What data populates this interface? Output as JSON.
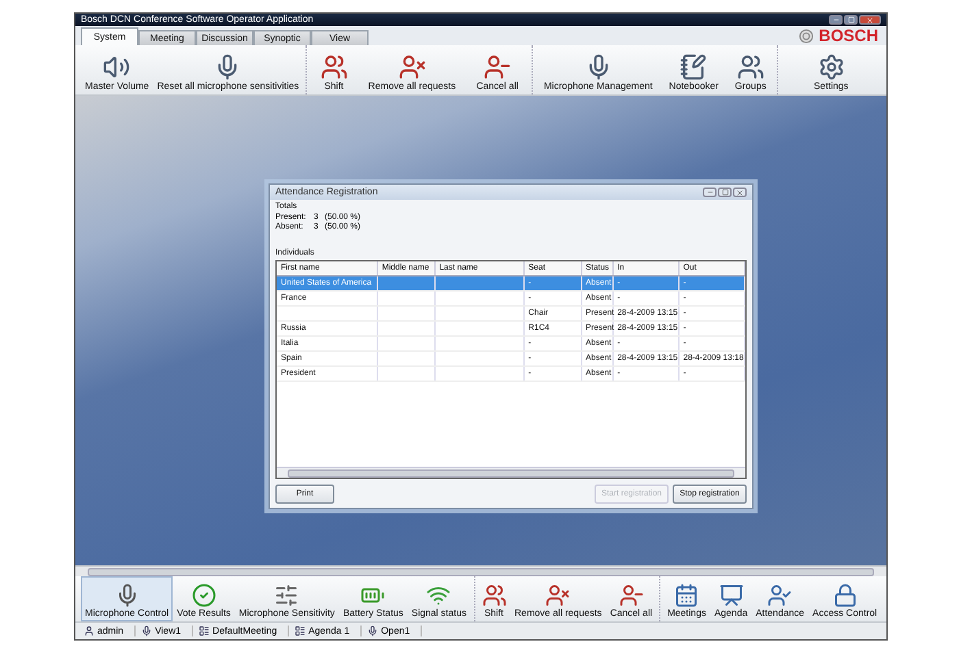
{
  "window": {
    "title": "Bosch DCN Conference Software Operator Application"
  },
  "tabs": [
    {
      "label": "System",
      "selected": true
    },
    {
      "label": "Meeting",
      "selected": false
    },
    {
      "label": "Discussion",
      "selected": false
    },
    {
      "label": "Synoptic",
      "selected": false
    },
    {
      "label": "View",
      "selected": false
    }
  ],
  "logo": "BOSCH",
  "toolbar": [
    [
      {
        "label": "Master Volume"
      },
      {
        "label": "Reset all microphone sensitivities"
      }
    ],
    [
      {
        "label": "Shift"
      },
      {
        "label": "Remove all requests"
      },
      {
        "label": "Cancel all"
      }
    ],
    [
      {
        "label": "Microphone Management"
      },
      {
        "label": "Notebooker"
      },
      {
        "label": "Groups"
      }
    ],
    [
      {
        "label": "Settings"
      }
    ]
  ],
  "dialog": {
    "title": "Attendance Registration",
    "totals_label": "Totals",
    "totals": [
      {
        "label": "Present:",
        "count": "3",
        "percent": "(50.00 %)"
      },
      {
        "label": "Absent:",
        "count": "3",
        "percent": "(50.00 %)"
      }
    ],
    "individuals_label": "Individuals",
    "columns": [
      "First name",
      "Middle name",
      "Last name",
      "Seat",
      "Status",
      "In",
      "Out"
    ],
    "rows": [
      {
        "cells": [
          "United States of America",
          "",
          "",
          "-",
          "Absent",
          "-",
          "-"
        ],
        "selected": true
      },
      {
        "cells": [
          "France",
          "",
          "",
          "-",
          "Absent",
          "-",
          "-"
        ],
        "selected": false
      },
      {
        "cells": [
          "",
          "",
          "",
          "Chair",
          "Present",
          "28-4-2009 13:15",
          "-"
        ],
        "selected": false
      },
      {
        "cells": [
          "Russia",
          "",
          "",
          "R1C4",
          "Present",
          "28-4-2009 13:15",
          "-"
        ],
        "selected": false
      },
      {
        "cells": [
          "Italia",
          "",
          "",
          "-",
          "Absent",
          "-",
          "-"
        ],
        "selected": false
      },
      {
        "cells": [
          "Spain",
          "",
          "",
          "-",
          "Absent",
          "28-4-2009 13:15",
          "28-4-2009 13:18"
        ],
        "selected": false
      },
      {
        "cells": [
          "President",
          "",
          "",
          "-",
          "Absent",
          "-",
          "-"
        ],
        "selected": false
      }
    ],
    "buttons": [
      {
        "label": "Print",
        "disabled": false
      },
      {
        "label": "Start registration",
        "disabled": true
      },
      {
        "label": "Stop registration",
        "disabled": false
      }
    ]
  },
  "bottom_toolbar": [
    [
      {
        "label": "Microphone Control",
        "selected": true
      },
      {
        "label": "Vote Results",
        "selected": false
      },
      {
        "label": "Microphone Sensitivity",
        "selected": false
      },
      {
        "label": "Battery Status",
        "selected": false
      },
      {
        "label": "Signal status",
        "selected": false
      }
    ],
    [
      {
        "label": "Shift",
        "selected": false
      },
      {
        "label": "Remove all requests",
        "selected": false
      },
      {
        "label": "Cancel all",
        "selected": false
      }
    ],
    [
      {
        "label": "Meetings",
        "selected": false
      },
      {
        "label": "Agenda",
        "selected": false
      },
      {
        "label": "Attendance",
        "selected": false
      },
      {
        "label": "Access Control",
        "selected": false
      }
    ]
  ],
  "status_bar": [
    "admin",
    "View1",
    "DefaultMeeting",
    "Agenda 1",
    "Open1"
  ]
}
